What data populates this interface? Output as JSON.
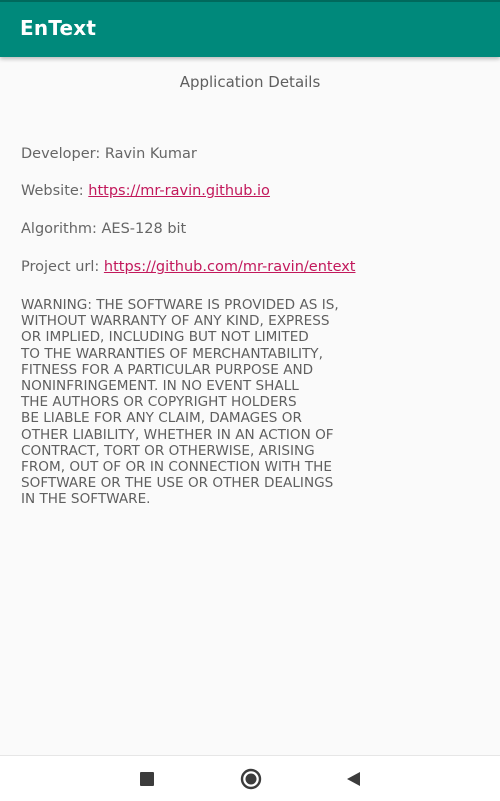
{
  "app": {
    "title": "EnText"
  },
  "details": {
    "heading": "Application Details",
    "developer_label": "Developer:",
    "developer_value": "Ravin Kumar",
    "website_label": "Website:",
    "website_link": "https://mr-ravin.github.io",
    "algorithm_label": "Algorithm:",
    "algorithm_value": "AES-128 bit",
    "project_label": "Project url:",
    "project_link": "https://github.com/mr-ravin/entext",
    "warning": "WARNING: THE SOFTWARE IS PROVIDED AS IS,\nWITHOUT WARRANTY OF ANY KIND, EXPRESS\nOR IMPLIED, INCLUDING BUT NOT LIMITED\nTO THE WARRANTIES OF MERCHANTABILITY,\nFITNESS FOR A PARTICULAR PURPOSE AND\nNONINFRINGEMENT. IN NO EVENT SHALL\nTHE AUTHORS OR COPYRIGHT HOLDERS\nBE LIABLE FOR ANY CLAIM, DAMAGES OR\nOTHER LIABILITY, WHETHER IN AN ACTION OF\nCONTRACT, TORT OR OTHERWISE, ARISING\nFROM, OUT OF OR IN CONNECTION WITH THE\nSOFTWARE OR THE USE OR OTHER DEALINGS\nIN THE SOFTWARE."
  },
  "navbar": {
    "icons": [
      "square-recents-icon",
      "circle-home-icon",
      "triangle-back-icon"
    ]
  },
  "colors": {
    "appbar": "#00897b",
    "link": "#c2185b",
    "background": "#fafafa"
  }
}
